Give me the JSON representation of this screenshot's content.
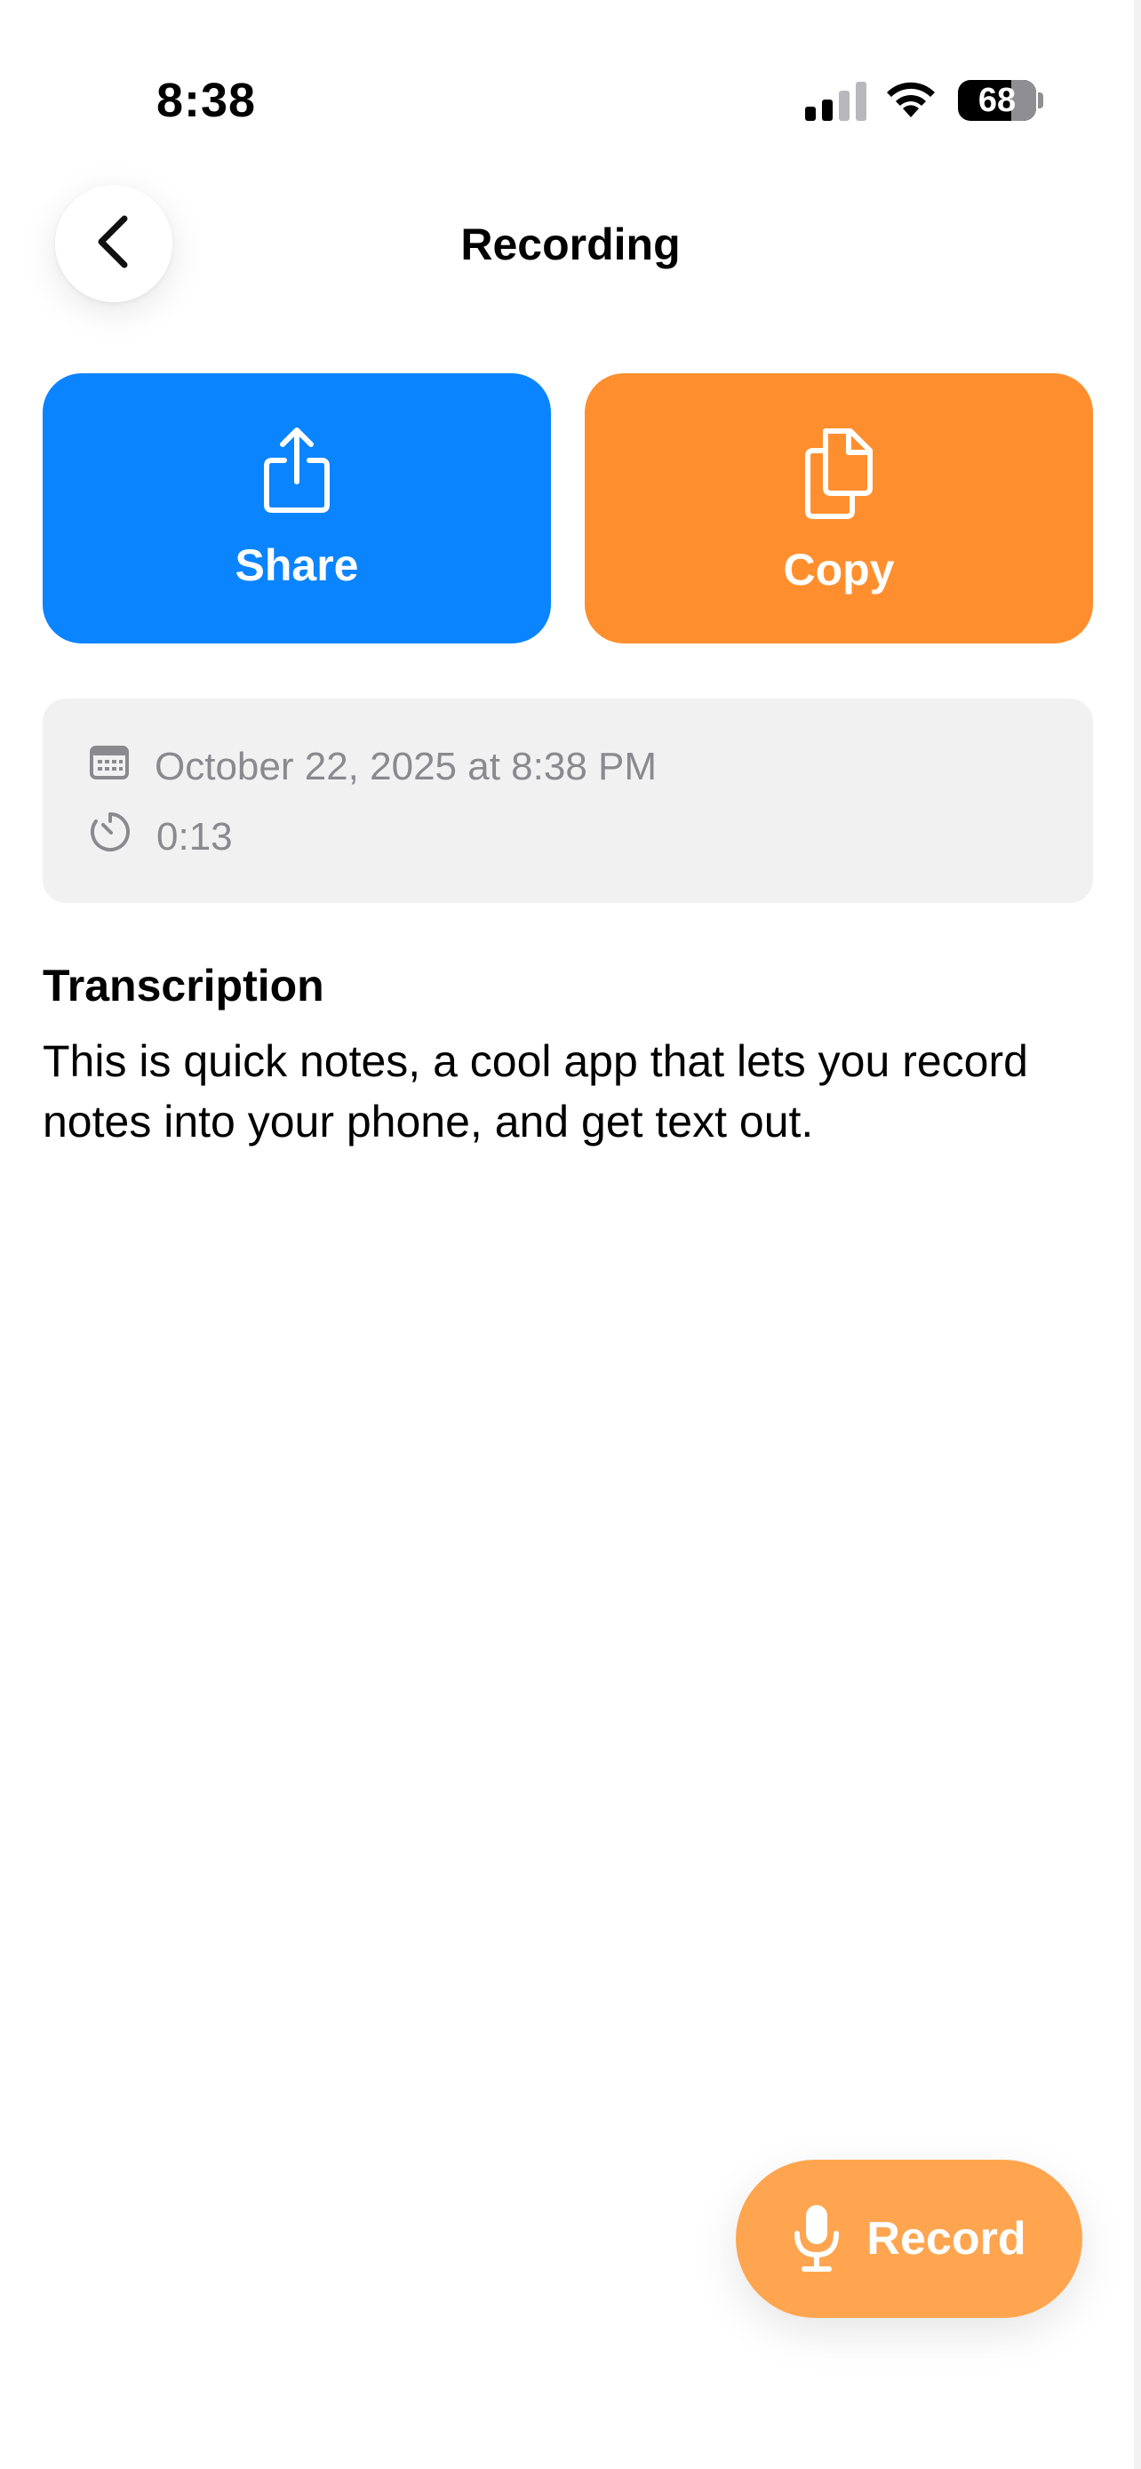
{
  "status_bar": {
    "time": "8:38",
    "battery_level": "68",
    "battery_fraction": 0.68
  },
  "header": {
    "title": "Recording",
    "back_icon": "chevron-left-icon"
  },
  "actions": {
    "share_label": "Share",
    "share_icon": "share-icon",
    "share_color": "#0a84ff",
    "copy_label": "Copy",
    "copy_icon": "copy-icon",
    "copy_color": "#ff8f2e"
  },
  "info": {
    "date": "October 22, 2025 at 8:38 PM",
    "date_icon": "calendar-icon",
    "duration": "0:13",
    "duration_icon": "timer-icon"
  },
  "transcription": {
    "heading": "Transcription",
    "text": "This is quick notes, a cool app that lets you record notes into your phone, and get text out."
  },
  "record_button": {
    "label": "Record",
    "icon": "microphone-icon",
    "color": "#ffa54f"
  }
}
